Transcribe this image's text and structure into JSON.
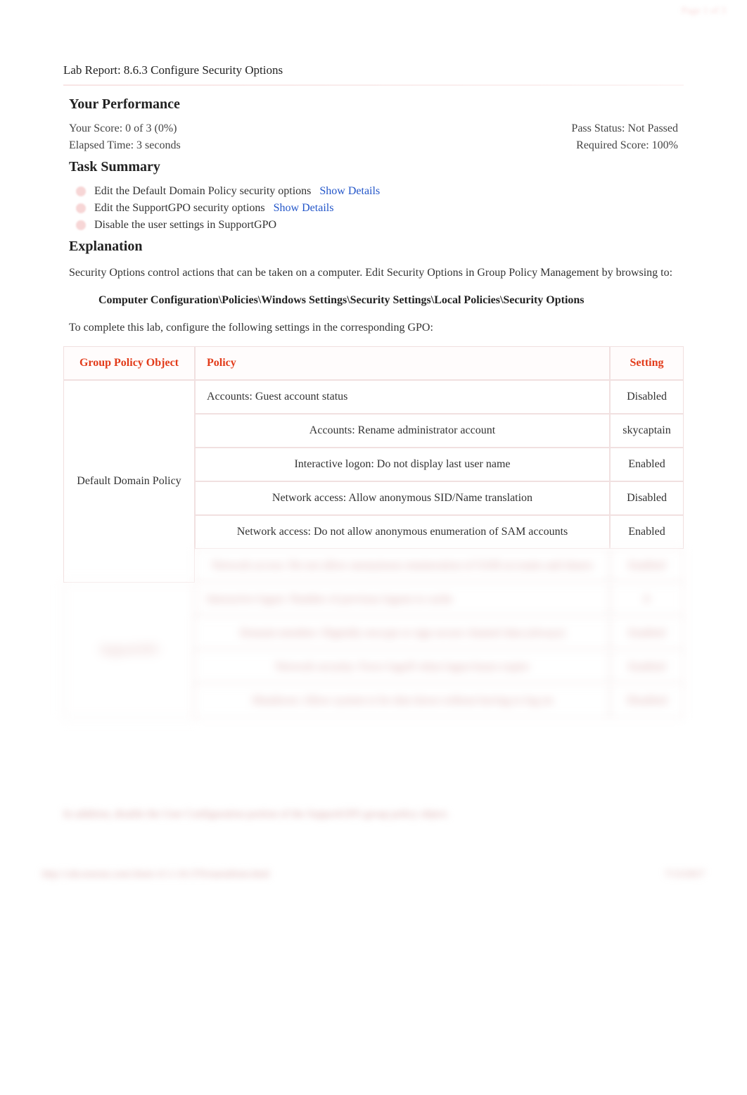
{
  "pageIndicator": "Page 1 of 3",
  "reportTitle": "Lab Report: 8.6.3 Configure Security Options",
  "performance": {
    "heading": "Your Performance",
    "scoreLabel": "Your Score: 0 of 3 (0%)",
    "passLabel": "Pass Status: Not Passed",
    "elapsedLabel": "Elapsed Time: 3 seconds",
    "requiredLabel": "Required Score: 100%"
  },
  "taskSummary": {
    "heading": "Task Summary",
    "showDetails": "Show Details",
    "tasks": [
      {
        "label": "Edit the Default Domain Policy security options",
        "hasDetails": true
      },
      {
        "label": "Edit the SupportGPO security options",
        "hasDetails": true
      },
      {
        "label": "Disable the user settings in SupportGPO",
        "hasDetails": false
      }
    ]
  },
  "explanation": {
    "heading": "Explanation",
    "intro": "Security Options control actions that can be taken on a computer. Edit Security Options in Group Policy Management by browsing to:",
    "path": "Computer Configuration\\Policies\\Windows Settings\\Security Settings\\Local Policies\\Security Options",
    "instruction": "To complete this lab, configure the following settings in the corresponding GPO:"
  },
  "table": {
    "headers": {
      "gpo": "Group Policy Object",
      "policy": "Policy",
      "setting": "Setting"
    },
    "groups": [
      {
        "gpo": "Default Domain Policy",
        "rows": [
          {
            "policy": "Accounts: Guest account status",
            "setting": "Disabled",
            "blurred": false
          },
          {
            "policy": "Accounts: Rename administrator account",
            "setting": "skycaptain",
            "blurred": false
          },
          {
            "policy": "Interactive logon: Do not display last user name",
            "setting": "Enabled",
            "blurred": false
          },
          {
            "policy": "Network access: Allow anonymous SID/Name translation",
            "setting": "Disabled",
            "blurred": false
          },
          {
            "policy": "Network access: Do not allow anonymous enumeration of SAM accounts",
            "setting": "Enabled",
            "blurred": false
          },
          {
            "policy": "Network access: Do not allow anonymous enumeration of SAM accounts and shares",
            "setting": "Enabled",
            "blurred": true
          }
        ]
      },
      {
        "gpo": "SupportGPO",
        "rows": [
          {
            "policy": "Interactive logon: Number of previous logons to cache",
            "setting": "0",
            "blurred": true
          },
          {
            "policy": "Domain member: Digitally encrypt or sign secure channel data (always)",
            "setting": "Enabled",
            "blurred": true
          },
          {
            "policy": "Network security: Force logoff when logon hours expire",
            "setting": "Enabled",
            "blurred": true
          },
          {
            "policy": "Shutdown: Allow system to be shut down without having to log on",
            "setting": "Disabled",
            "blurred": true
          }
        ]
      }
    ]
  },
  "footerNote": "In addition, disable the User Configuration portion of the SupportGPO group policy object.",
  "footerLeft": "http://cdn.testout.com/client-v5-1-10-370/startallsim.html",
  "footerRight": "7/13/2017"
}
